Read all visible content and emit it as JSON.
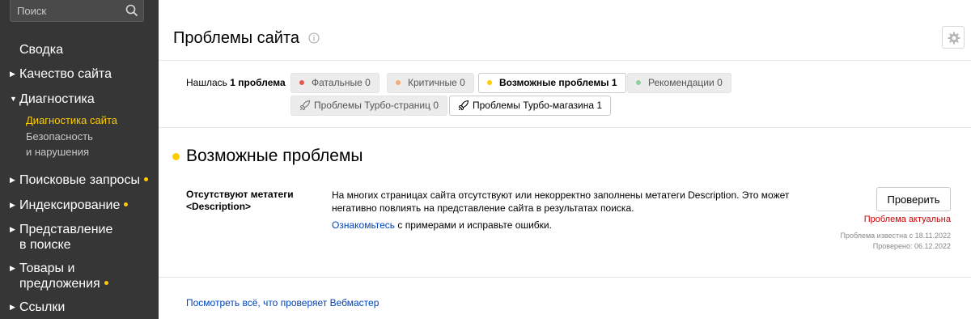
{
  "sidebar": {
    "search_placeholder": "Поиск",
    "items": [
      {
        "label": "Сводка"
      },
      {
        "label": "Качество сайта"
      },
      {
        "label": "Диагностика"
      },
      {
        "label": "Поисковые запросы"
      },
      {
        "label": "Индексирование"
      },
      {
        "label_line1": "Представление",
        "label_line2": "в поиске"
      },
      {
        "label_line1": "Товары и",
        "label_line2": "предложения"
      },
      {
        "label": "Ссылки"
      }
    ],
    "sub_items": [
      {
        "label": "Диагностика сайта"
      },
      {
        "label_line1": "Безопасность",
        "label_line2": "и нарушения"
      }
    ],
    "accent_color": "#ffcc00"
  },
  "header": {
    "title": "Проблемы сайта"
  },
  "filters": {
    "found_prefix": "Нашлась",
    "found_bold": "1 проблема",
    "tabs": [
      {
        "label": "Фатальные",
        "count": "0",
        "dot_color": "#e05a4e"
      },
      {
        "label": "Критичные",
        "count": "0",
        "dot_color": "#f5a97a"
      },
      {
        "label": "Возможные проблемы",
        "count": "1",
        "dot_color": "#ffcc00"
      },
      {
        "label": "Рекомендации",
        "count": "0",
        "dot_color": "#8fd19e"
      },
      {
        "label": "Проблемы Турбо-страниц",
        "count": "0"
      },
      {
        "label": "Проблемы Турбо-магазина",
        "count": "1"
      }
    ]
  },
  "section": {
    "title": "Возможные проблемы"
  },
  "issue": {
    "name": "Отсутствуют метатеги <Description>",
    "description": "На многих страницах сайта отсутствуют или некорректно заполнены метатеги Description. Это может негативно повлиять на представление сайта в результатах поиска.",
    "more_link": "Ознакомьтесь",
    "more_rest": " с примерами и исправьте ошибки.",
    "check_label": "Проверить",
    "status": "Проблема актуальна",
    "known_since": "Проблема известна с 18.11.2022",
    "checked": "Проверено: 06.12.2022",
    "status_color": "#cc0000"
  },
  "footer": {
    "link": "Посмотреть всё, что проверяет Вебмастер"
  }
}
